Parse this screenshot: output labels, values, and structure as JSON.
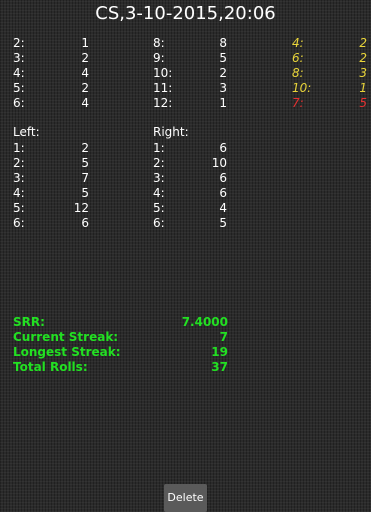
{
  "title": "CS,3-10-2015,20:06",
  "counts_col1": [
    {
      "k": "2:",
      "v": "1"
    },
    {
      "k": "3:",
      "v": "2"
    },
    {
      "k": "4:",
      "v": "4"
    },
    {
      "k": "5:",
      "v": "2"
    },
    {
      "k": "6:",
      "v": "4"
    }
  ],
  "counts_col2": [
    {
      "k": "8:",
      "v": "8"
    },
    {
      "k": "9:",
      "v": "5"
    },
    {
      "k": "10:",
      "v": "2"
    },
    {
      "k": "11:",
      "v": "3"
    },
    {
      "k": "12:",
      "v": "1"
    }
  ],
  "counts_col3": [
    {
      "k": "4:",
      "v": "2",
      "color": "#e8d43a"
    },
    {
      "k": "6:",
      "v": "2",
      "color": "#e8d43a"
    },
    {
      "k": "8:",
      "v": "3",
      "color": "#e8d43a"
    },
    {
      "k": "10:",
      "v": "1",
      "color": "#e8d43a"
    },
    {
      "k": "7:",
      "v": "5",
      "color": "#e53030"
    }
  ],
  "left": {
    "label": "Left:",
    "rows": [
      {
        "k": "1:",
        "v": "2"
      },
      {
        "k": "2:",
        "v": "5"
      },
      {
        "k": "3:",
        "v": "7"
      },
      {
        "k": "4:",
        "v": "5"
      },
      {
        "k": "5:",
        "v": "12"
      },
      {
        "k": "6:",
        "v": "6"
      }
    ]
  },
  "right": {
    "label": "Right:",
    "rows": [
      {
        "k": "1:",
        "v": "6"
      },
      {
        "k": "2:",
        "v": "10"
      },
      {
        "k": "3:",
        "v": "6"
      },
      {
        "k": "4:",
        "v": "6"
      },
      {
        "k": "5:",
        "v": "4"
      },
      {
        "k": "6:",
        "v": "5"
      }
    ]
  },
  "stats": [
    {
      "k": "SRR:",
      "v": "7.4000"
    },
    {
      "k": "Current Streak:",
      "v": "7"
    },
    {
      "k": "Longest Streak:",
      "v": "19"
    },
    {
      "k": "Total Rolls:",
      "v": "37"
    }
  ],
  "delete_label": "Delete",
  "colors": {
    "stats_green": "#22e022",
    "hard_way_yellow": "#e8d43a",
    "seven_red": "#e53030"
  }
}
